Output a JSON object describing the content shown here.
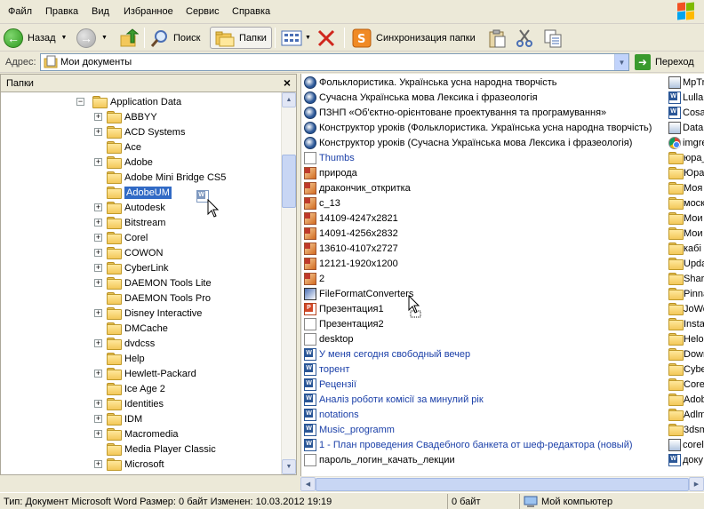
{
  "menu": [
    "Файл",
    "Правка",
    "Вид",
    "Избранное",
    "Сервис",
    "Справка"
  ],
  "toolbar": {
    "back": "Назад",
    "search": "Поиск",
    "folders": "Папки",
    "sync": "Синхронизация папки"
  },
  "address": {
    "label": "Адрес:",
    "value": "Мои документы",
    "go": "Переход"
  },
  "folder_pane": {
    "title": "Папки",
    "items": [
      {
        "label": "Application Data",
        "level": 0,
        "expand": "minus"
      },
      {
        "label": "ABBYY",
        "level": 1,
        "expand": "plus"
      },
      {
        "label": "ACD Systems",
        "level": 1,
        "expand": "plus"
      },
      {
        "label": "Ace",
        "level": 1,
        "expand": "none"
      },
      {
        "label": "Adobe",
        "level": 1,
        "expand": "plus"
      },
      {
        "label": "Adobe Mini Bridge CS5",
        "level": 1,
        "expand": "none"
      },
      {
        "label": "AdobeUM",
        "level": 1,
        "expand": "none",
        "selected": true
      },
      {
        "label": "Autodesk",
        "level": 1,
        "expand": "plus"
      },
      {
        "label": "Bitstream",
        "level": 1,
        "expand": "plus"
      },
      {
        "label": "Corel",
        "level": 1,
        "expand": "plus"
      },
      {
        "label": "COWON",
        "level": 1,
        "expand": "plus"
      },
      {
        "label": "CyberLink",
        "level": 1,
        "expand": "plus"
      },
      {
        "label": "DAEMON Tools Lite",
        "level": 1,
        "expand": "plus"
      },
      {
        "label": "DAEMON Tools Pro",
        "level": 1,
        "expand": "none"
      },
      {
        "label": "Disney Interactive",
        "level": 1,
        "expand": "plus"
      },
      {
        "label": "DMCache",
        "level": 1,
        "expand": "none"
      },
      {
        "label": "dvdcss",
        "level": 1,
        "expand": "plus"
      },
      {
        "label": "Help",
        "level": 1,
        "expand": "none"
      },
      {
        "label": "Hewlett-Packard",
        "level": 1,
        "expand": "plus"
      },
      {
        "label": "Ice Age 2",
        "level": 1,
        "expand": "none"
      },
      {
        "label": "Identities",
        "level": 1,
        "expand": "plus"
      },
      {
        "label": "IDM",
        "level": 1,
        "expand": "plus"
      },
      {
        "label": "Macromedia",
        "level": 1,
        "expand": "plus"
      },
      {
        "label": "Media Player Classic",
        "level": 1,
        "expand": "none"
      },
      {
        "label": "Microsoft",
        "level": 1,
        "expand": "plus"
      }
    ]
  },
  "files": [
    {
      "label": "Фольклористика. Українська усна народна творчість",
      "icon": "shortcut",
      "blue": false
    },
    {
      "label": "Сучасна Українська мова Лексика і фразеологія",
      "icon": "shortcut",
      "blue": false
    },
    {
      "label": "ПЗНП «Об'єктно-орієнтоване проектування та програмування»",
      "icon": "shortcut",
      "blue": false
    },
    {
      "label": "Конструктор уроків (Фольклористика. Українська усна народна творчість)",
      "icon": "shortcut",
      "blue": false
    },
    {
      "label": "Конструктор уроків (Сучасна Українська мова Лексика і фразеологія)",
      "icon": "shortcut",
      "blue": false
    },
    {
      "label": "Thumbs",
      "icon": "plain",
      "blue": true
    },
    {
      "label": "природа",
      "icon": "image",
      "blue": false
    },
    {
      "label": "дракончик_откритка",
      "icon": "image",
      "blue": false
    },
    {
      "label": "c_13",
      "icon": "image",
      "blue": false
    },
    {
      "label": "14109-4247x2821",
      "icon": "image",
      "blue": false
    },
    {
      "label": "14091-4256x2832",
      "icon": "image",
      "blue": false
    },
    {
      "label": "13610-4107x2727",
      "icon": "image",
      "blue": false
    },
    {
      "label": "12121-1920x1200",
      "icon": "image",
      "blue": false
    },
    {
      "label": "2",
      "icon": "image",
      "blue": false
    },
    {
      "label": "FileFormatConverters",
      "icon": "ffc",
      "blue": false
    },
    {
      "label": "Презентация1",
      "icon": "ppt",
      "blue": false
    },
    {
      "label": "Презентация2",
      "icon": "plain",
      "blue": false
    },
    {
      "label": "desktop",
      "icon": "plain",
      "blue": false
    },
    {
      "label": "У меня сегодня свободный вечер",
      "icon": "doc",
      "blue": true
    },
    {
      "label": "торент",
      "icon": "doc",
      "blue": true
    },
    {
      "label": "Рецензії",
      "icon": "doc",
      "blue": true
    },
    {
      "label": "Аналіз роботи комісії за минулий рік",
      "icon": "doc",
      "blue": true
    },
    {
      "label": "notations",
      "icon": "doc",
      "blue": true
    },
    {
      "label": "Music_programm",
      "icon": "doc",
      "blue": true
    },
    {
      "label": "1 - План проведения Свадебного банкета от шеф-редактора (новый)",
      "icon": "doc",
      "blue": true
    },
    {
      "label": "пароль_логин_качать_лекции",
      "icon": "plain",
      "blue": false
    }
  ],
  "files_col2": [
    {
      "label": "MpTr",
      "icon": "app"
    },
    {
      "label": "Lullab",
      "icon": "doc"
    },
    {
      "label": "Cosa",
      "icon": "doc"
    },
    {
      "label": "Data",
      "icon": "app"
    },
    {
      "label": "imgre",
      "icon": "chrome"
    },
    {
      "label": "юра_",
      "icon": "folder"
    },
    {
      "label": "Юра",
      "icon": "folder"
    },
    {
      "label": "Моя",
      "icon": "folder"
    },
    {
      "label": "моск",
      "icon": "folder"
    },
    {
      "label": "Мои",
      "icon": "folder"
    },
    {
      "label": "Мои",
      "icon": "folder"
    },
    {
      "label": "кабі",
      "icon": "folder"
    },
    {
      "label": "Upda",
      "icon": "folder"
    },
    {
      "label": "Sharl",
      "icon": "folder"
    },
    {
      "label": "Pinna",
      "icon": "folder"
    },
    {
      "label": "JoWo",
      "icon": "folder"
    },
    {
      "label": "Insta",
      "icon": "folder"
    },
    {
      "label": "Helo",
      "icon": "folder"
    },
    {
      "label": "Dowr",
      "icon": "folder"
    },
    {
      "label": "Cybe",
      "icon": "folder"
    },
    {
      "label": "Core",
      "icon": "folder"
    },
    {
      "label": "Adob",
      "icon": "folder"
    },
    {
      "label": "Adlm",
      "icon": "folder"
    },
    {
      "label": "3dsm",
      "icon": "folder"
    },
    {
      "label": "corel",
      "icon": "app"
    },
    {
      "label": "доку",
      "icon": "doc"
    }
  ],
  "status": {
    "info": "Тип: Документ Microsoft Word Размер: 0 байт Изменен: 10.03.2012 19:19",
    "size": "0 байт",
    "location": "Мой компьютер"
  }
}
